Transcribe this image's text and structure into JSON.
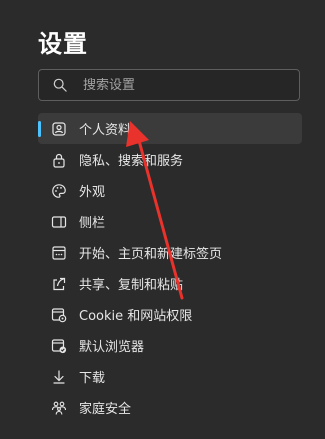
{
  "header": {
    "title": "设置"
  },
  "search": {
    "placeholder": "搜索设置",
    "icon": "search-icon"
  },
  "sidebar": {
    "items": [
      {
        "label": "个人资料",
        "icon": "profile-icon",
        "active": true
      },
      {
        "label": "隐私、搜索和服务",
        "icon": "lock-icon"
      },
      {
        "label": "外观",
        "icon": "palette-icon"
      },
      {
        "label": "侧栏",
        "icon": "sidebar-panel-icon"
      },
      {
        "label": "开始、主页和新建标签页",
        "icon": "home-tabs-icon"
      },
      {
        "label": "共享、复制和粘贴",
        "icon": "share-icon"
      },
      {
        "label": "Cookie 和网站权限",
        "icon": "site-permissions-icon"
      },
      {
        "label": "默认浏览器",
        "icon": "default-browser-icon"
      },
      {
        "label": "下载",
        "icon": "download-icon"
      },
      {
        "label": "家庭安全",
        "icon": "family-icon"
      }
    ]
  },
  "colors": {
    "background": "#2b2b2b",
    "active_item_background": "#3b3b3b",
    "active_indicator": "#4cc2ff",
    "annotation_arrow": "#e8322b"
  }
}
